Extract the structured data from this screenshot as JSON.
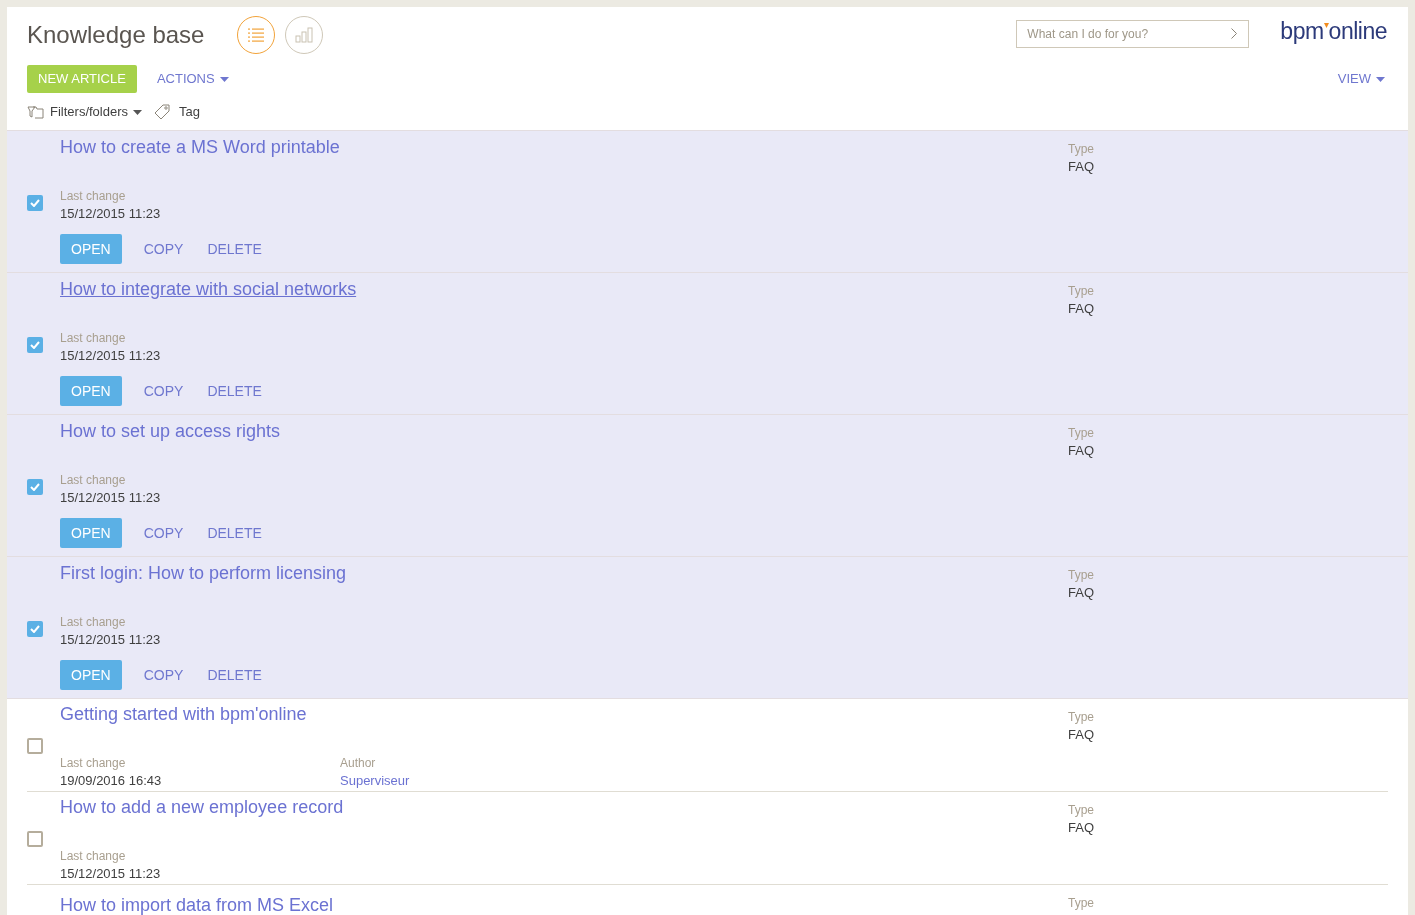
{
  "header": {
    "title": "Knowledge base",
    "views": [
      {
        "kind": "list",
        "selected": true
      },
      {
        "kind": "chart",
        "selected": false
      }
    ],
    "search": {
      "placeholder": "What can I do for you?"
    },
    "logo": {
      "prefix": "bpm",
      "suffix": "online"
    }
  },
  "toolbar": {
    "primary": "NEW ARTICLE",
    "actions": "ACTIONS",
    "view": "VIEW"
  },
  "filters": {
    "folders": "Filters/folders",
    "tag": "Tag"
  },
  "articles": [
    {
      "title": "How to create a MS Word printable",
      "selected": true,
      "hovered": false,
      "fields": [
        {
          "label": "Last change",
          "value": "15/12/2015 11:23",
          "kind": "text"
        }
      ],
      "type_label": "Type",
      "type": "FAQ",
      "actions": [
        {
          "label": "OPEN",
          "kind": "primary"
        },
        {
          "label": "COPY",
          "kind": "link"
        },
        {
          "label": "DELETE",
          "kind": "link"
        }
      ]
    },
    {
      "title": "How to integrate with social networks",
      "selected": true,
      "hovered": true,
      "fields": [
        {
          "label": "Last change",
          "value": "15/12/2015 11:23",
          "kind": "text"
        }
      ],
      "type_label": "Type",
      "type": "FAQ",
      "actions": [
        {
          "label": "OPEN",
          "kind": "primary"
        },
        {
          "label": "COPY",
          "kind": "link"
        },
        {
          "label": "DELETE",
          "kind": "link"
        }
      ]
    },
    {
      "title": "How to set up access rights",
      "selected": true,
      "hovered": false,
      "fields": [
        {
          "label": "Last change",
          "value": "15/12/2015 11:23",
          "kind": "text"
        }
      ],
      "type_label": "Type",
      "type": "FAQ",
      "actions": [
        {
          "label": "OPEN",
          "kind": "primary"
        },
        {
          "label": "COPY",
          "kind": "link"
        },
        {
          "label": "DELETE",
          "kind": "link"
        }
      ]
    },
    {
      "title": "First login: How to perform licensing",
      "selected": true,
      "hovered": false,
      "fields": [
        {
          "label": "Last change",
          "value": "15/12/2015 11:23",
          "kind": "text"
        }
      ],
      "type_label": "Type",
      "type": "FAQ",
      "actions": [
        {
          "label": "OPEN",
          "kind": "primary"
        },
        {
          "label": "COPY",
          "kind": "link"
        },
        {
          "label": "DELETE",
          "kind": "link"
        }
      ]
    },
    {
      "title": "Getting started with bpm'online",
      "selected": false,
      "hovered": false,
      "fields": [
        {
          "label": "Last change",
          "value": "19/09/2016 16:43",
          "kind": "text"
        },
        {
          "label": "Author",
          "value": "Superviseur",
          "kind": "link"
        }
      ],
      "type_label": "Type",
      "type": "FAQ"
    },
    {
      "title": "How to add a new employee record",
      "selected": false,
      "hovered": false,
      "fields": [
        {
          "label": "Last change",
          "value": "15/12/2015 11:23",
          "kind": "text"
        }
      ],
      "type_label": "Type",
      "type": "FAQ"
    },
    {
      "title": "How to import data from MS Excel",
      "hovered": false,
      "type_label": "Type"
    }
  ]
}
